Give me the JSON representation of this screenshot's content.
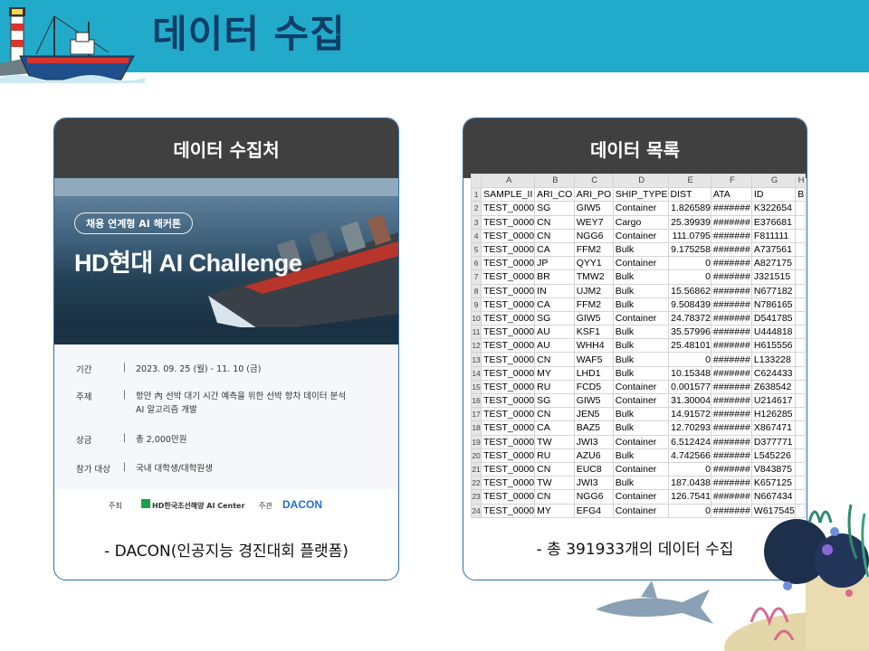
{
  "header": {
    "title": "데이터 수집"
  },
  "left_card": {
    "title": "데이터 수집처",
    "poster": {
      "badge": "채용 연계형 AI 해커톤",
      "title": "HD현대 AI Challenge",
      "rows": [
        {
          "key": "기간",
          "value": "2023. 09. 25 (월) - 11. 10 (금)"
        },
        {
          "key": "주제",
          "value": "항만 內 선박 대기 시간 예측을 위한 선박 항차 데이터 분석",
          "value2": "AI 알고리즘 개발"
        },
        {
          "key": "상금",
          "value": "총 2,000만원"
        },
        {
          "key": "참가 대상",
          "value": "국내 대학생/대학원생"
        }
      ],
      "footer": {
        "host_label": "주최",
        "host": "HD한국조선해양 AI Center",
        "organizer_label": "주관",
        "organizer": "DACON"
      }
    },
    "caption": "- DACON(인공지능 경진대회 플랫폼)"
  },
  "right_card": {
    "title": "데이터 목록",
    "sheet": {
      "columns": [
        "A",
        "B",
        "C",
        "D",
        "E",
        "F",
        "G",
        "H"
      ],
      "headers": [
        "SAMPLE_II",
        "ARI_CO",
        "ARI_PO",
        "SHIP_TYPE",
        "DIST",
        "ATA",
        "ID",
        "B"
      ],
      "rows": [
        [
          "TEST_0000",
          "SG",
          "GIW5",
          "Container",
          "1.826589",
          "#######",
          "K322654"
        ],
        [
          "TEST_0000",
          "CN",
          "WEY7",
          "Cargo",
          "25.39939",
          "#######",
          "E376681"
        ],
        [
          "TEST_0000",
          "CN",
          "NGG6",
          "Container",
          "111.0795",
          "#######",
          "F811111"
        ],
        [
          "TEST_0000",
          "CA",
          "FFM2",
          "Bulk",
          "9.175258",
          "#######",
          "A737561"
        ],
        [
          "TEST_0000",
          "JP",
          "QYY1",
          "Container",
          "0",
          "#######",
          "A827175"
        ],
        [
          "TEST_0000",
          "BR",
          "TMW2",
          "Bulk",
          "0",
          "#######",
          "J321515"
        ],
        [
          "TEST_0000",
          "IN",
          "UJM2",
          "Bulk",
          "15.56862",
          "#######",
          "N677182"
        ],
        [
          "TEST_0000",
          "CA",
          "FFM2",
          "Bulk",
          "9.508439",
          "#######",
          "N786165"
        ],
        [
          "TEST_0000",
          "SG",
          "GIW5",
          "Container",
          "24.78372",
          "#######",
          "D541785"
        ],
        [
          "TEST_0000",
          "AU",
          "KSF1",
          "Bulk",
          "35.57996",
          "#######",
          "U444818"
        ],
        [
          "TEST_0000",
          "AU",
          "WHH4",
          "Bulk",
          "25.48101",
          "#######",
          "H615556"
        ],
        [
          "TEST_0000",
          "CN",
          "WAF5",
          "Bulk",
          "0",
          "#######",
          "L133228"
        ],
        [
          "TEST_0000",
          "MY",
          "LHD1",
          "Bulk",
          "10.15348",
          "#######",
          "C624433"
        ],
        [
          "TEST_0000",
          "RU",
          "FCD5",
          "Container",
          "0.001577",
          "#######",
          "Z638542"
        ],
        [
          "TEST_0000",
          "SG",
          "GIW5",
          "Container",
          "31.30004",
          "#######",
          "U214617"
        ],
        [
          "TEST_0000",
          "CN",
          "JEN5",
          "Bulk",
          "14.91572",
          "#######",
          "H126285"
        ],
        [
          "TEST_0000",
          "CA",
          "BAZ5",
          "Bulk",
          "12.70293",
          "#######",
          "X867471"
        ],
        [
          "TEST_0000",
          "TW",
          "JWI3",
          "Container",
          "6.512424",
          "#######",
          "D377771"
        ],
        [
          "TEST_0000",
          "RU",
          "AZU6",
          "Bulk",
          "4.742566",
          "#######",
          "L545226"
        ],
        [
          "TEST_0000",
          "CN",
          "EUC8",
          "Container",
          "0",
          "#######",
          "V843875"
        ],
        [
          "TEST_0000",
          "TW",
          "JWI3",
          "Bulk",
          "187.0438",
          "#######",
          "K657125"
        ],
        [
          "TEST_0000",
          "CN",
          "NGG6",
          "Container",
          "126.7541",
          "#######",
          "N667434"
        ],
        [
          "TEST_0000",
          "MY",
          "EFG4",
          "Container",
          "0",
          "#######",
          "W617545"
        ]
      ]
    },
    "caption": "- 총 391933개의 데이터 수집"
  },
  "colors": {
    "header_bg": "#22aacb",
    "title_text": "#0e3f66",
    "card_border": "#2f6fa6",
    "card_head": "#404040"
  }
}
